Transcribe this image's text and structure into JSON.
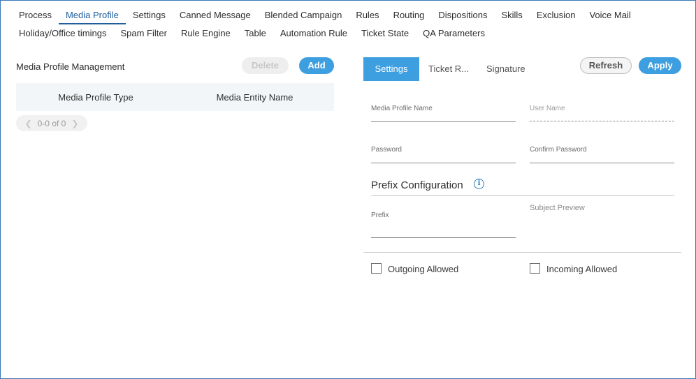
{
  "nav": {
    "row1": [
      "Process",
      "Media Profile",
      "Settings",
      "Canned Message",
      "Blended Campaign",
      "Rules",
      "Routing",
      "Dispositions",
      "Skills",
      "Exclusion",
      "Voice Mail"
    ],
    "row2": [
      "Holiday/Office timings",
      "Spam Filter",
      "Rule Engine",
      "Table",
      "Automation Rule",
      "Ticket State",
      "QA Parameters"
    ],
    "active": "Media Profile"
  },
  "left": {
    "title": "Media Profile Management",
    "delete_label": "Delete",
    "add_label": "Add",
    "columns": [
      "Media Profile Type",
      "Media Entity Name"
    ],
    "pager_text": "0-0 of 0"
  },
  "right": {
    "tabs": [
      "Settings",
      "Ticket R...",
      "Signature"
    ],
    "refresh_label": "Refresh",
    "apply_label": "Apply",
    "fields": {
      "media_profile_name": "Media Profile Name",
      "user_name": "User Name",
      "password": "Password",
      "confirm_password": "Confirm Password",
      "prefix": "Prefix"
    },
    "prefix_config_title": "Prefix Configuration",
    "subject_preview_label": "Subject Preview",
    "outgoing_label": "Outgoing Allowed",
    "incoming_label": "Incoming Allowed",
    "outgoing_checked": false,
    "incoming_checked": false
  },
  "colors": {
    "accent": "#3d9ee0",
    "active_nav": "#1e5e9e",
    "frame_border": "#3a78b8"
  }
}
